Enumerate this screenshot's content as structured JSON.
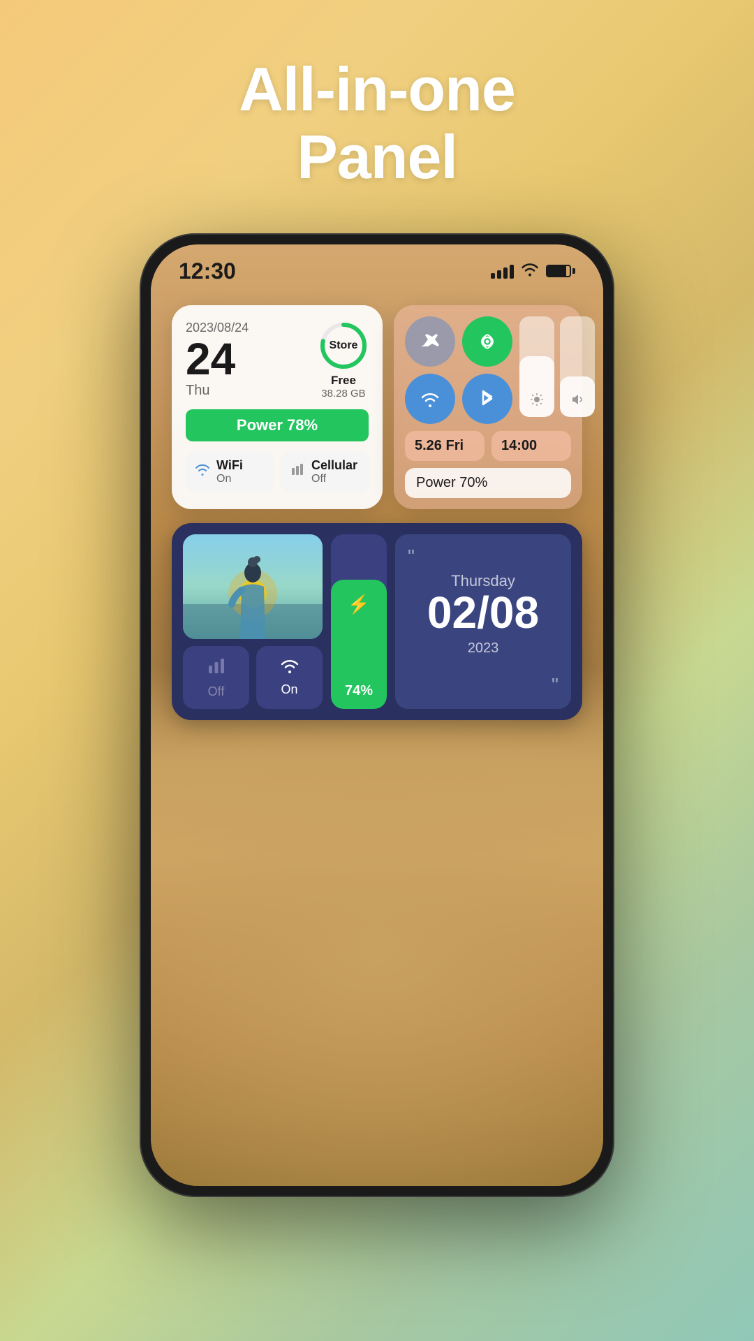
{
  "page": {
    "title_line1": "All-in-one",
    "title_line2": "Panel"
  },
  "status_bar": {
    "time": "12:30"
  },
  "widget1": {
    "date": "2023/08/24",
    "day_number": "24",
    "weekday": "Thu",
    "storage_label": "Store",
    "storage_free": "Free",
    "storage_amount": "38.28 GB",
    "power_label": "Power 78%",
    "wifi_name": "WiFi",
    "wifi_status": "On",
    "cellular_name": "Cellular",
    "cellular_status": "Off"
  },
  "widget2": {
    "date_info": "5.26 Fri",
    "time_info": "14:00",
    "power_label": "Power 70%"
  },
  "widget3": {
    "cellular_label": "Off",
    "wifi_label": "On",
    "battery_percent": "74%",
    "date_day": "Thursday",
    "date_number": "02/08",
    "date_year": "2023"
  }
}
